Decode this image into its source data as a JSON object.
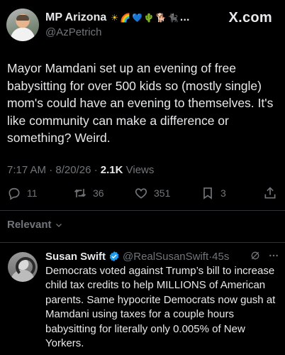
{
  "watermark": "X.com",
  "post": {
    "author": {
      "display_name": "MP Arizona",
      "handle": "@AzPetrich",
      "name_emojis": [
        "☀",
        "🌈",
        "💙",
        "🌵",
        "🐕",
        "🐈‍⬛",
        "..."
      ]
    },
    "text": "Mayor Mamdani set up an evening of free babysitting for over 500 kids so (mostly single) mom's could have an evening to themselves. It's like community can make a difference or something? Weird.",
    "time": "7:17 AM",
    "date": "8/20/26",
    "views_count": "2.1K",
    "views_label": "Views",
    "actions": {
      "replies": "11",
      "reposts": "36",
      "likes": "351",
      "bookmarks": "3"
    }
  },
  "sort": {
    "label": "Relevant"
  },
  "reply": {
    "display_name": "Susan Swift",
    "handle": "@RealSusanSwift",
    "separator": "·",
    "time_ago": "45s",
    "verified_color": "#1d9bf0",
    "text": "Democrats voted against Trump’s bill to increase child tax credits to help MILLIONS of American parents.  Same hypocrite Democrats now gush at Mamdani using taxes for a couple hours babysitting for literally only 0.005% of New Yorkers."
  }
}
